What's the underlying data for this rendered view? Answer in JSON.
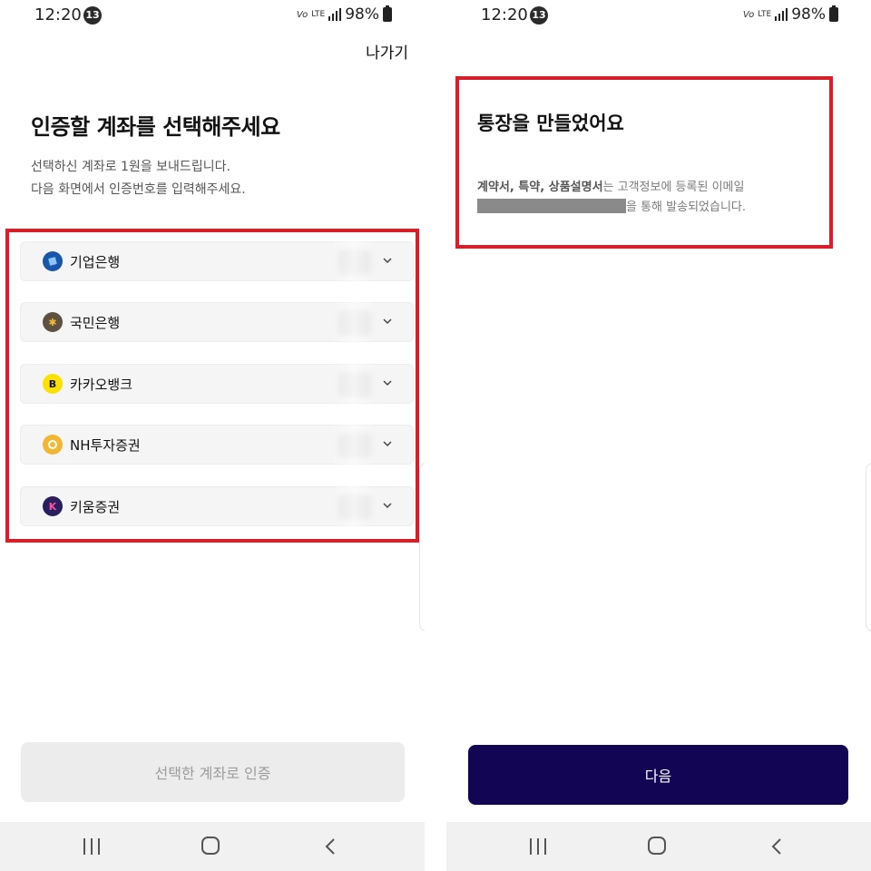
{
  "status_bar": {
    "time": "12:20",
    "badge": "13",
    "vlte": "Vo",
    "network": "LTE",
    "battery": "98%"
  },
  "left_screen": {
    "exit_label": "나가기",
    "title": "인증할 계좌를 선택해주세요",
    "description_line1": "선택하신 계좌로 1원을 보내드립니다.",
    "description_line2": "다음 화면에서 인증번호를 입력해주세요.",
    "banks": [
      {
        "name": "기업은행",
        "icon": "ibk-bank-icon",
        "color": "#1756a9",
        "glyph": "i"
      },
      {
        "name": "국민은행",
        "icon": "kb-bank-icon",
        "color": "#5e5142",
        "glyph": "✱"
      },
      {
        "name": "카카오뱅크",
        "icon": "kakaobank-icon",
        "color": "#ffe100",
        "glyph": "B"
      },
      {
        "name": "NH투자증권",
        "icon": "nh-securities-icon",
        "color": "#f2b632",
        "glyph": "●"
      },
      {
        "name": "키움증권",
        "icon": "kiwoom-securities-icon",
        "color": "#2a1f5e",
        "glyph": "K"
      }
    ],
    "confirm_button": "선택한 계좌로 인증"
  },
  "right_screen": {
    "title": "통장을 만들었어요",
    "desc_bold": "계약서, 특약, 상품설명서",
    "desc_part1": "는 고객정보에 등록된 이메일",
    "desc_part2": "을 통해 발송되었습니다.",
    "next_button": "다음"
  },
  "colors": {
    "highlight_red": "#d71f2a",
    "primary_navy": "#120654",
    "disabled_bg": "#ececec"
  }
}
